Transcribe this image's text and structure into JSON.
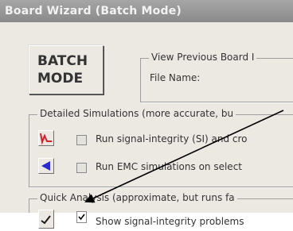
{
  "window": {
    "title": "Board Wizard (Batch Mode)"
  },
  "batch_button": {
    "line1": "BATCH",
    "line2": "MODE"
  },
  "view_group": {
    "label": "View Previous Board I",
    "file_name_label": "File Name:"
  },
  "detailed": {
    "legend": "Detailed Simulations (more accurate, bu",
    "rows": [
      {
        "icon": "signal-integrity-waveform-icon",
        "label": "Run signal-integrity (SI) and cro",
        "checked": false
      },
      {
        "icon": "emc-arrow-icon",
        "label": "Run EMC simulations on select",
        "checked": false
      }
    ]
  },
  "quick": {
    "legend": "Quick Analysis (approximate, but runs fa",
    "rows": [
      {
        "icon": "signal-integrity-check-icon",
        "label": "Show signal-integrity problems",
        "checked": true
      }
    ]
  }
}
